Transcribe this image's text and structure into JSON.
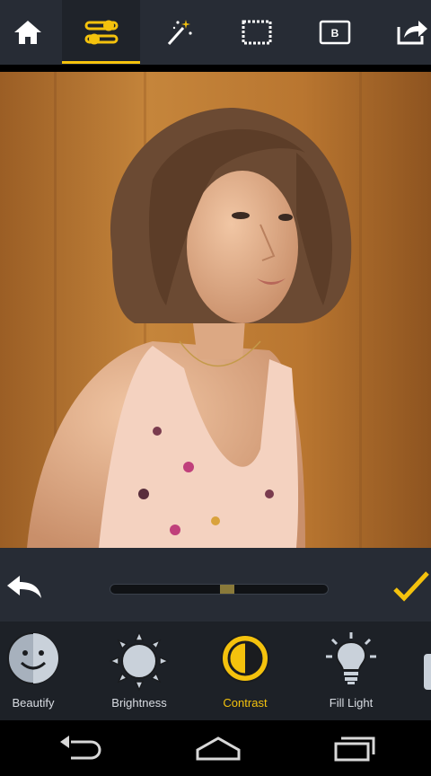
{
  "toolbar": {
    "icons": [
      "home-icon",
      "adjust-toggles-icon",
      "magic-wand-icon",
      "frame-icon",
      "border-icon",
      "share-icon"
    ],
    "active": "adjust-toggles-icon",
    "border_letter": "B"
  },
  "photo": {
    "description_icon": "portrait-photo"
  },
  "adjust": {
    "undo_icon": "undo-icon",
    "confirm_icon": "checkmark-icon",
    "slider_value": 0.54
  },
  "tools": [
    {
      "label": "Beautify",
      "icon": "face-icon"
    },
    {
      "label": "Brightness",
      "icon": "sun-icon"
    },
    {
      "label": "Contrast",
      "icon": "contrast-icon"
    },
    {
      "label": "Fill Light",
      "icon": "bulb-icon"
    }
  ],
  "active_tool": "Contrast",
  "colors": {
    "accent": "#f4c20d",
    "toolbar": "#272c35",
    "tools_bg": "#1d2127"
  },
  "nav": [
    "back-icon",
    "home-nav-icon",
    "recents-icon"
  ]
}
